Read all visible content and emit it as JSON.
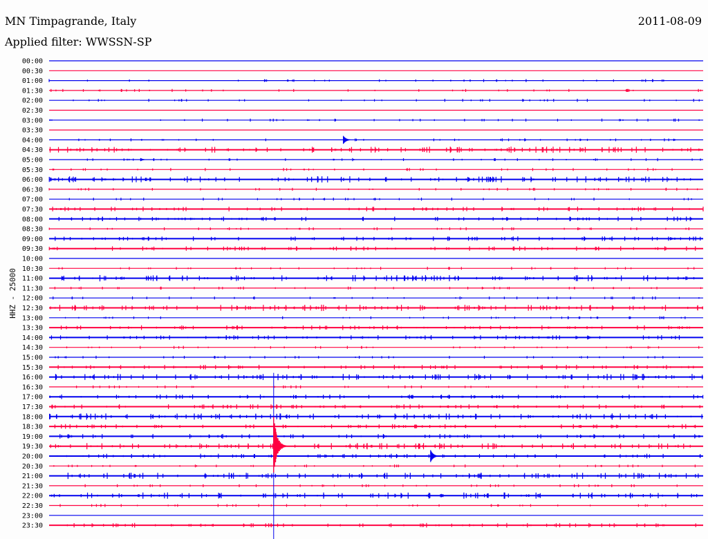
{
  "header": {
    "station": "MN Timpagrande, Italy",
    "filter": "Applied filter: WWSSN-SP",
    "date": "2011-08-09"
  },
  "chart_data": {
    "type": "line",
    "title": "MN Timpagrande, Italy",
    "subtitle": "Applied filter: WWSSN-SP",
    "ylabel": "HHZ - 25000",
    "xlabel": "",
    "x_unit": "minutes within row",
    "xlim": [
      0,
      30
    ],
    "colors": [
      "#0000ee",
      "#ff0040"
    ],
    "rows": [
      "00:00",
      "00:30",
      "01:00",
      "01:30",
      "02:00",
      "02:30",
      "03:00",
      "03:30",
      "04:00",
      "04:30",
      "05:00",
      "05:30",
      "06:00",
      "06:30",
      "07:00",
      "07:30",
      "08:00",
      "08:30",
      "09:00",
      "09:30",
      "10:00",
      "10:30",
      "11:00",
      "11:30",
      "12:00",
      "12:30",
      "13:00",
      "13:30",
      "14:00",
      "14:30",
      "15:00",
      "15:30",
      "16:00",
      "16:30",
      "17:00",
      "17:30",
      "18:00",
      "18:30",
      "19:00",
      "19:30",
      "20:00",
      "20:30",
      "21:00",
      "21:30",
      "22:00",
      "22:30",
      "23:00",
      "23:30"
    ],
    "noise_level": [
      0,
      0,
      1,
      1,
      1,
      0,
      1,
      0,
      1,
      3,
      1,
      1,
      3,
      1,
      1,
      2,
      2,
      1,
      2,
      2,
      0,
      1,
      3,
      1,
      1,
      3,
      1,
      2,
      2,
      1,
      1,
      2,
      3,
      1,
      2,
      2,
      3,
      2,
      2,
      3,
      2,
      1,
      3,
      1,
      3,
      1,
      0,
      2
    ],
    "events": [
      {
        "row": "04:00",
        "minute": 13.5,
        "amplitude_rows": 0.4
      },
      {
        "row": "05:00",
        "minute": 4.2,
        "amplitude_rows": 0.15
      },
      {
        "row": "14:00",
        "minute": 24.7,
        "amplitude_rows": 0.2
      },
      {
        "row": "19:30",
        "minute": 10.3,
        "amplitude_rows": 3.2
      },
      {
        "row": "20:00",
        "minute": 17.5,
        "amplitude_rows": 0.6
      },
      {
        "row": "09:00",
        "minute": 28.5,
        "amplitude_rows": 0.15
      }
    ]
  }
}
